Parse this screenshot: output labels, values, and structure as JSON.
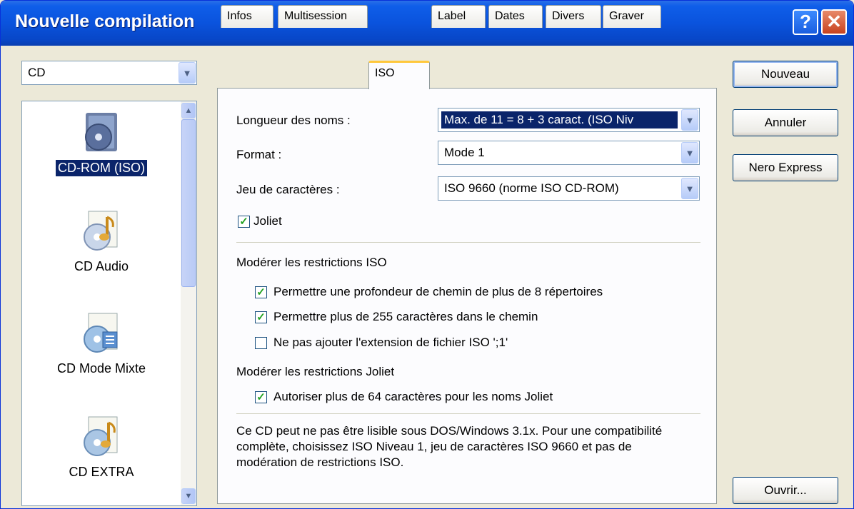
{
  "window": {
    "title": "Nouvelle compilation",
    "help_label": "?",
    "close_label": "✕"
  },
  "disc_type": {
    "value": "CD"
  },
  "project_list": {
    "items": [
      {
        "label": "CD-ROM (ISO)",
        "icon": "cd-rom-iso-icon",
        "selected": true
      },
      {
        "label": "CD Audio",
        "icon": "cd-audio-icon",
        "selected": false
      },
      {
        "label": "CD Mode Mixte",
        "icon": "cd-mixed-mode-icon",
        "selected": false
      },
      {
        "label": "CD EXTRA",
        "icon": "cd-extra-icon",
        "selected": false
      }
    ]
  },
  "tabs": [
    {
      "label": "Infos"
    },
    {
      "label": "Multisession"
    },
    {
      "label": "ISO",
      "active": true
    },
    {
      "label": "Label"
    },
    {
      "label": "Dates"
    },
    {
      "label": "Divers"
    },
    {
      "label": "Graver"
    }
  ],
  "iso": {
    "name_length": {
      "label": "Longueur des noms :",
      "value": "Max. de 11 = 8 + 3 caract. (ISO Niv"
    },
    "format": {
      "label": "Format :",
      "value": "Mode 1"
    },
    "charset": {
      "label": "Jeu de caractères :",
      "value": "ISO 9660 (norme ISO CD-ROM)"
    },
    "joliet": {
      "label": "Joliet",
      "checked": true
    },
    "relax_iso": {
      "title": "Modérer les restrictions ISO",
      "options": [
        {
          "label": "Permettre une profondeur de chemin de plus de 8 répertoires",
          "checked": true
        },
        {
          "label": "Permettre plus de 255 caractères dans le chemin",
          "checked": true
        },
        {
          "label": "Ne pas ajouter l'extension de fichier ISO ';1'",
          "checked": false
        }
      ]
    },
    "relax_joliet": {
      "title": "Modérer les restrictions Joliet",
      "options": [
        {
          "label": "Autoriser plus de 64 caractères pour les noms Joliet",
          "checked": true
        }
      ]
    },
    "note": "Ce CD peut ne pas être lisible sous DOS/Windows 3.1x. Pour une compatibilité complète, choisissez ISO Niveau 1, jeu de caractères ISO 9660 et pas de modération de restrictions ISO."
  },
  "buttons": {
    "new": "Nouveau",
    "cancel": "Annuler",
    "nero_express": "Nero Express",
    "open": "Ouvrir..."
  },
  "colors": {
    "titlebar": "#0a53dd",
    "selection": "#0a246a",
    "check": "#21a121",
    "active_tab_accent": "#ffc83c"
  }
}
